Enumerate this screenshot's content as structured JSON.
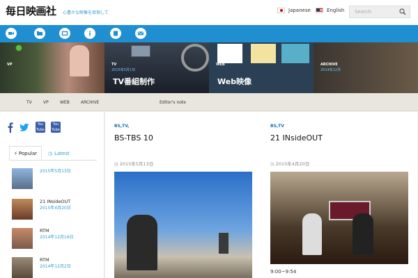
{
  "header": {
    "logo": "毎日映画社",
    "tagline": "心豊かな映像を目指して",
    "lang_ja": "Japanese",
    "lang_en": "English",
    "search_placeholder": "Search"
  },
  "hero": [
    {
      "tag": "VP",
      "date": "",
      "title": "",
      "color": "#6a4a3a"
    },
    {
      "tag": "TV",
      "date": "2015年5月1日",
      "title": "TV番組制作",
      "color": "#1a1f2a"
    },
    {
      "tag": "WEB",
      "date": "",
      "title": "Web映像",
      "color": "#2b4054"
    },
    {
      "tag": "ARCHIVE",
      "date": "2014年12月",
      "title": "",
      "color": "#4b4036"
    }
  ],
  "submenu": [
    "TV",
    "VP",
    "WEB",
    "ARCHIVE",
    "Editor's note"
  ],
  "sidebar": {
    "tab_popular": "Popular",
    "tab_latest": "Latest",
    "recent": [
      {
        "title": "",
        "date": "2015年5月13日",
        "color": "#6a8fb8"
      },
      {
        "title": "21 INsideOUT",
        "date": "2015年4月20日",
        "color": "#8a5a3a"
      },
      {
        "title": "RTM",
        "date": "2014年12月16日",
        "color": "#b07a5a"
      },
      {
        "title": "RTM",
        "date": "2014年12月2日",
        "color": "#7a6a5a"
      }
    ]
  },
  "articles": [
    {
      "cat": "BS,TV,",
      "title": "BS-TBS 10",
      "date": "2015年5月13日",
      "caption": ""
    },
    {
      "cat": "BS,TV",
      "title": "21 INsideOUT",
      "date": "2015年4月20日",
      "caption": "9:00~9:54"
    }
  ],
  "colors": {
    "accent": "#1f8fd1",
    "link": "#3399cc",
    "submenu_bg": "#e9e6dd"
  }
}
